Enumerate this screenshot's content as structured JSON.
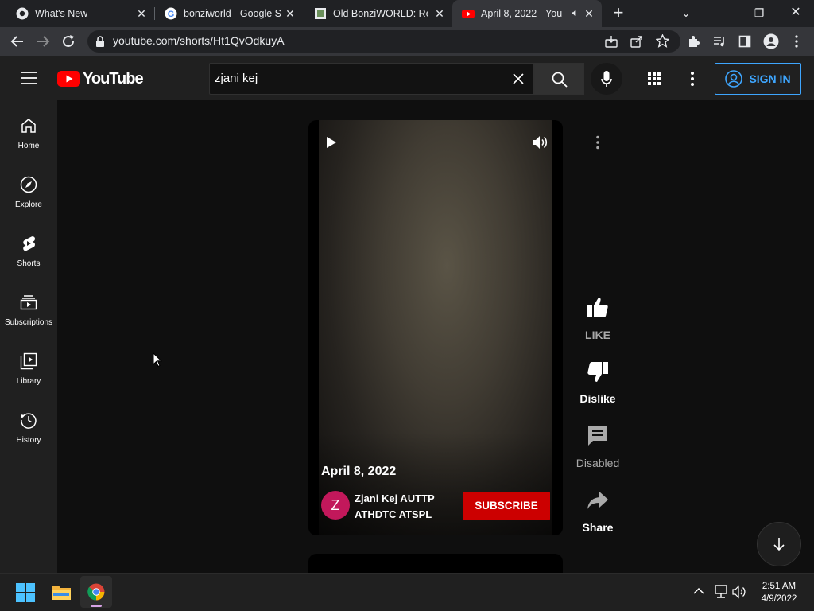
{
  "browser": {
    "tabs": [
      {
        "title": "What's New",
        "active": false
      },
      {
        "title": "bonziworld - Google Se",
        "active": false
      },
      {
        "title": "Old BonziWORLD: Revi",
        "active": false
      },
      {
        "title": "April 8, 2022 - You",
        "active": true
      }
    ],
    "new_tab_label": "+",
    "url": "youtube.com/shorts/Ht1QvOdkuyA"
  },
  "youtube": {
    "logo_text": "YouTube",
    "search_value": "zjani kej",
    "signin_label": "SIGN IN",
    "brand_red": "#ff0000",
    "accent_blue": "#3ea6ff"
  },
  "sidebar": {
    "items": [
      {
        "label": "Home",
        "icon": "home-icon"
      },
      {
        "label": "Explore",
        "icon": "compass-icon"
      },
      {
        "label": "Shorts",
        "icon": "shorts-icon"
      },
      {
        "label": "Subscriptions",
        "icon": "subscriptions-icon"
      },
      {
        "label": "Library",
        "icon": "library-icon"
      },
      {
        "label": "History",
        "icon": "history-icon"
      }
    ]
  },
  "short": {
    "date_title": "April 8, 2022",
    "channel_initial": "Z",
    "channel_name": "Zjani Kej AUTTP ATHDTC ATSPL",
    "subscribe_label": "SUBSCRIBE",
    "subscribe_color": "#cc0000"
  },
  "actions": {
    "like": "LIKE",
    "dislike": "Dislike",
    "comments": "Disabled",
    "share": "Share"
  },
  "taskbar": {
    "time": "2:51 AM",
    "date": "4/9/2022"
  }
}
